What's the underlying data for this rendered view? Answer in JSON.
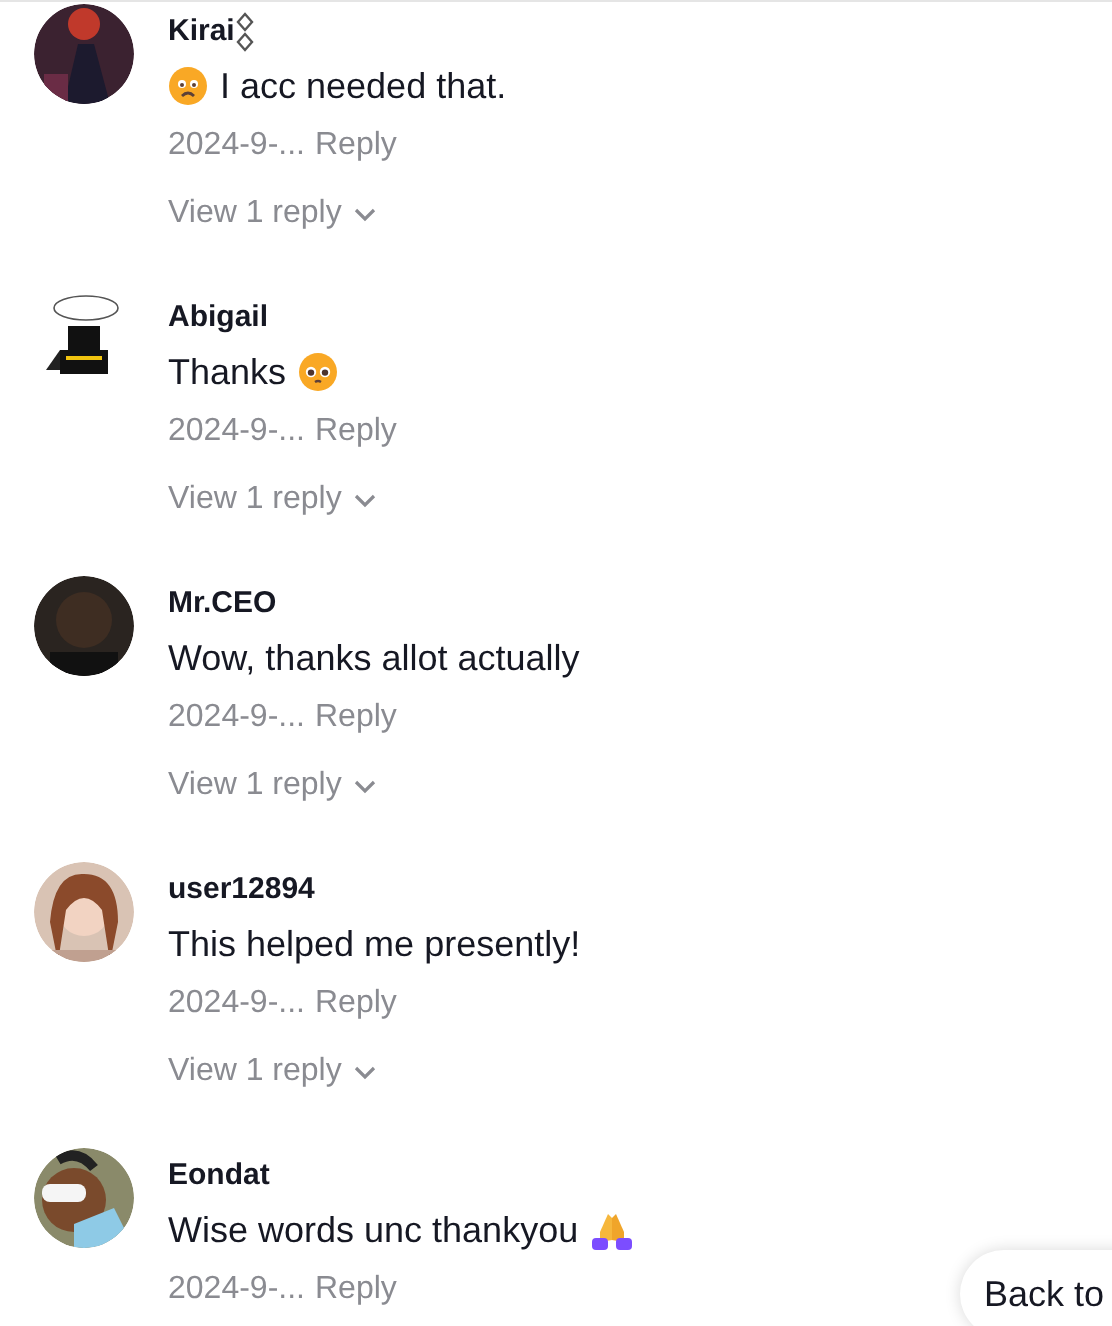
{
  "comments": [
    {
      "author": "Kirai",
      "author_badge": true,
      "parts": [
        {
          "kind": "worried-emoji"
        },
        {
          "kind": "text",
          "text": "I acc needed that."
        }
      ],
      "date": "2024-9-...",
      "reply": "Reply",
      "view_replies": "View 1 reply"
    },
    {
      "author": "Abigail",
      "author_badge": false,
      "parts": [
        {
          "kind": "text",
          "text": "Thanks"
        },
        {
          "kind": "pleading-emoji"
        }
      ],
      "date": "2024-9-...",
      "reply": "Reply",
      "view_replies": "View 1 reply"
    },
    {
      "author": "Mr.CEO",
      "author_badge": false,
      "parts": [
        {
          "kind": "text",
          "text": "Wow, thanks allot actually"
        }
      ],
      "date": "2024-9-...",
      "reply": "Reply",
      "view_replies": "View 1 reply"
    },
    {
      "author": "user12894",
      "author_badge": false,
      "parts": [
        {
          "kind": "text",
          "text": "This helped me presently!"
        }
      ],
      "date": "2024-9-...",
      "reply": "Reply",
      "view_replies": "View 1 reply"
    },
    {
      "author": "Eondat",
      "author_badge": false,
      "parts": [
        {
          "kind": "text",
          "text": "Wise words unc thankyou"
        },
        {
          "kind": "praying-emoji"
        }
      ],
      "date": "2024-9-...",
      "reply": "Reply"
    }
  ],
  "back_button": "Back to"
}
